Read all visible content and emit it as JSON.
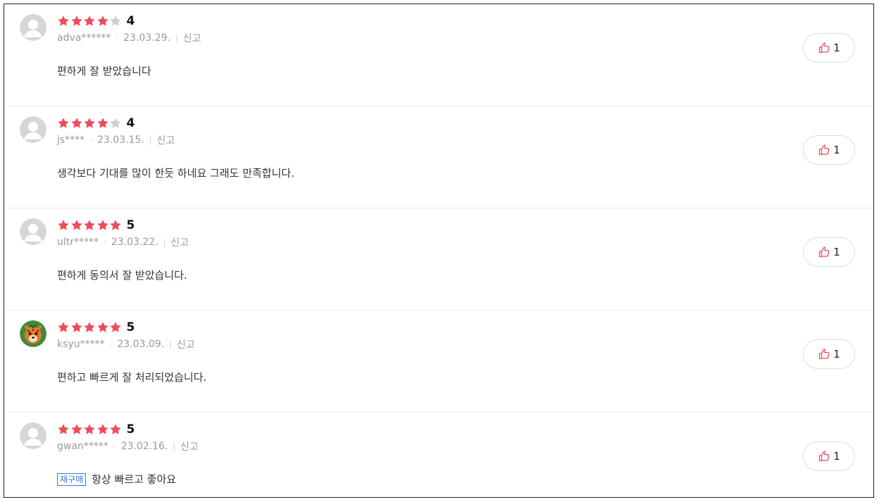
{
  "colors": {
    "star_filled": "#ef4b58",
    "star_empty": "#cfcfcf",
    "tag": "#3b7bd1",
    "thumb": "#ef4b58"
  },
  "reviews": [
    {
      "rating": 4,
      "score_label": "4",
      "user": "adva******",
      "date": "23.03.29.",
      "report": "신고",
      "tag": "",
      "text": "편하게 잘 받았습니다",
      "likes": "1",
      "avatar": "default-avatar-icon"
    },
    {
      "rating": 4,
      "score_label": "4",
      "user": "js****",
      "date": "23.03.15.",
      "report": "신고",
      "tag": "",
      "text": "생각보다 기대를 많이 한듯 하네요 그래도 만족합니다.",
      "likes": "1",
      "avatar": "default-avatar-icon"
    },
    {
      "rating": 5,
      "score_label": "5",
      "user": "ultr*****",
      "date": "23.03.22.",
      "report": "신고",
      "tag": "",
      "text": "편하게 동의서 잘 받았습니다.",
      "likes": "1",
      "avatar": "default-avatar-icon"
    },
    {
      "rating": 5,
      "score_label": "5",
      "user": "ksyu*****",
      "date": "23.03.09.",
      "report": "신고",
      "tag": "",
      "text": "편하고 빠르게 잘 처리되었습니다.",
      "likes": "1",
      "avatar": "tiger-avatar-icon"
    },
    {
      "rating": 5,
      "score_label": "5",
      "user": "gwan*****",
      "date": "23.02.16.",
      "report": "신고",
      "tag": "재구매",
      "text": "항상 빠르고 좋아요",
      "likes": "1",
      "avatar": "default-avatar-icon"
    }
  ]
}
